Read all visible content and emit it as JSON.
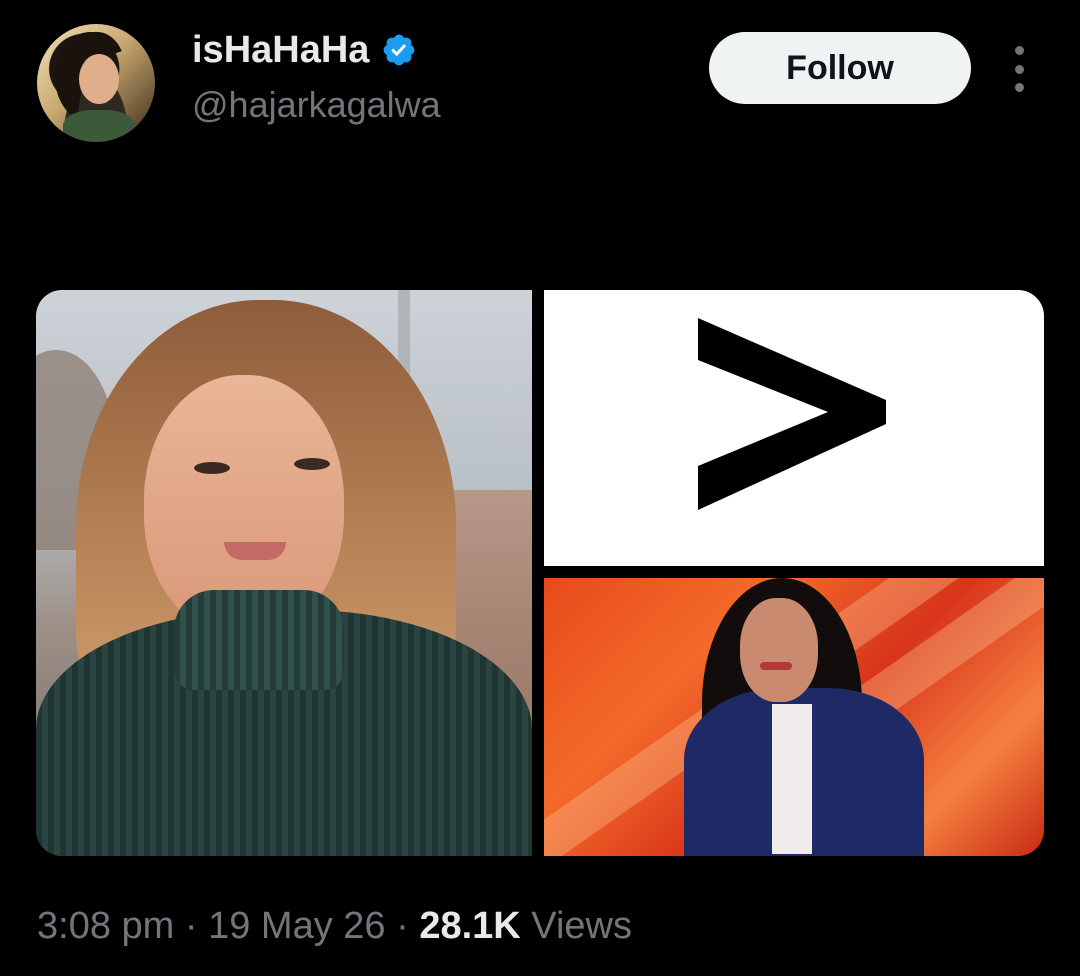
{
  "user": {
    "display_name": "isHaHaHa",
    "handle": "@hajarkagalwa",
    "verified": true
  },
  "actions": {
    "follow_label": "Follow"
  },
  "media": {
    "symbol": ">"
  },
  "meta": {
    "time": "3:08 pm",
    "separator": " · ",
    "date": "19 May 26",
    "views_count": "28.1K",
    "views_label": "Views"
  },
  "colors": {
    "background": "#000000",
    "text_primary": "#e7e9ea",
    "text_secondary": "#71767b",
    "verified_badge": "#1d9bf0",
    "follow_button_bg": "#eff3f4"
  }
}
